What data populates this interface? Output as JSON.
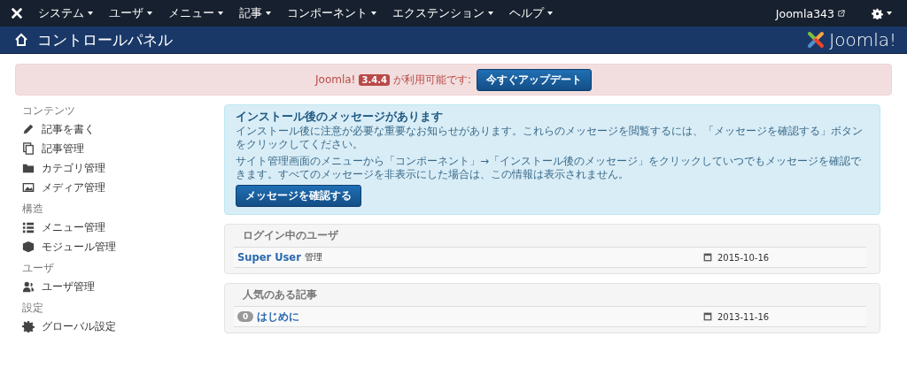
{
  "topbar": {
    "menus": [
      {
        "label": "システム"
      },
      {
        "label": "ユーザ"
      },
      {
        "label": "メニュー"
      },
      {
        "label": "記事"
      },
      {
        "label": "コンポーネント"
      },
      {
        "label": "エクステンション"
      },
      {
        "label": "ヘルプ"
      }
    ],
    "site_link": "Joomla343"
  },
  "header": {
    "title": "コントロールパネル",
    "logo_text": "Joomla!"
  },
  "update_alert": {
    "prefix": "Joomla!",
    "version": "3.4.4",
    "suffix": "が利用可能です:",
    "button": "今すぐアップデート"
  },
  "sidebar": [
    {
      "heading": "コンテンツ",
      "items": [
        {
          "label": "記事を書く"
        },
        {
          "label": "記事管理"
        },
        {
          "label": "カテゴリ管理"
        },
        {
          "label": "メディア管理"
        }
      ]
    },
    {
      "heading": "構造",
      "items": [
        {
          "label": "メニュー管理"
        },
        {
          "label": "モジュール管理"
        }
      ]
    },
    {
      "heading": "ユーザ",
      "items": [
        {
          "label": "ユーザ管理"
        }
      ]
    },
    {
      "heading": "設定",
      "items": [
        {
          "label": "グローバル設定"
        }
      ]
    }
  ],
  "postinstall": {
    "title": "インストール後のメッセージがあります",
    "paragraphs": [
      "インストール後に注意が必要な重要なお知らせがあります。これらのメッセージを閲覧するには、「メッセージを確認する」ボタンをクリックしてください。",
      "サイト管理画面のメニューから「コンポーネント」→「インストール後のメッセージ」をクリックしていつでもメッセージを確認できます。すべてのメッセージを非表示にした場合は、この情報は表示されません。"
    ],
    "button": "メッセージを確認する"
  },
  "panels": [
    {
      "title": "ログイン中のユーザ",
      "rows": [
        {
          "kind": "user",
          "name": "Super User",
          "role": "管理",
          "date": "2015-10-16"
        }
      ]
    },
    {
      "title": "人気のある記事",
      "rows": [
        {
          "kind": "article",
          "hits": "0",
          "name": "はじめに",
          "date": "2013-11-16"
        }
      ]
    }
  ]
}
